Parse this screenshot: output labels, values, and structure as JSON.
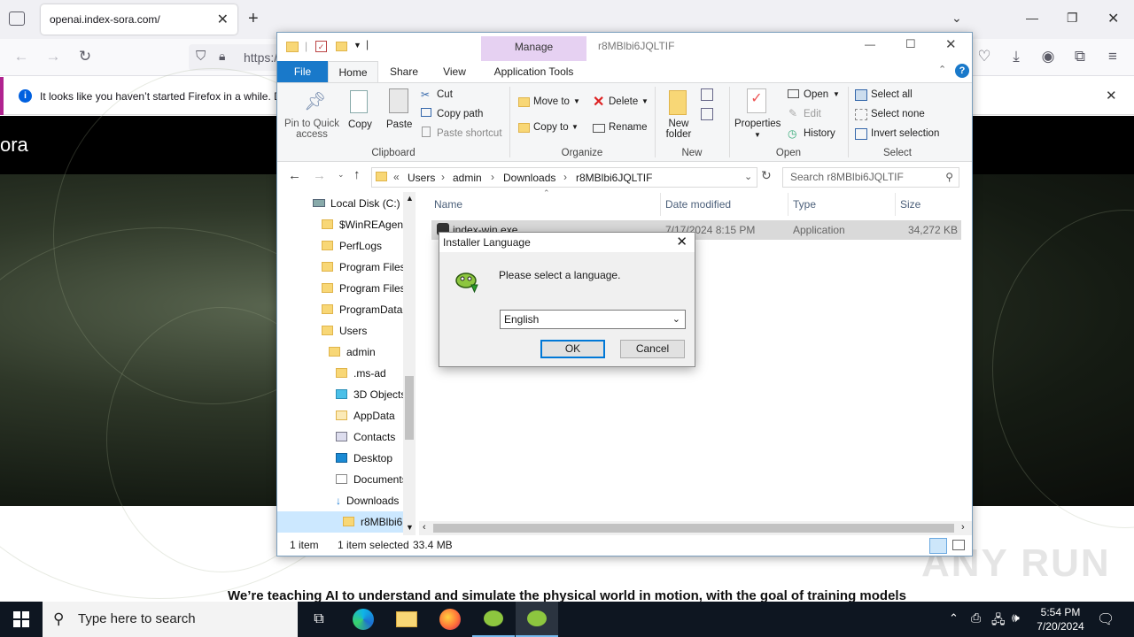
{
  "browser": {
    "tab_title": "openai.index-sora.com/",
    "url_partial": "https:/",
    "notification": "It looks like you haven’t started Firefox in a while. D",
    "new_tab_symbol": "+"
  },
  "page": {
    "brand": "ora",
    "tagline": "We’re teaching AI to understand and simulate the physical world in motion, with the goal of training models",
    "watermark": "ANY RUN"
  },
  "explorer": {
    "window_title": "r8MBlbi6JQLTIF",
    "context_tab": "Manage",
    "tabs": [
      "File",
      "Home",
      "Share",
      "View",
      "Application Tools"
    ],
    "ribbon": {
      "pin": "Pin to Quick access",
      "copy": "Copy",
      "paste": "Paste",
      "cut": "Cut",
      "copy_path": "Copy path",
      "paste_shortcut": "Paste shortcut",
      "move_to": "Move to",
      "copy_to": "Copy to",
      "delete": "Delete",
      "rename": "Rename",
      "new_folder": "New folder",
      "properties": "Properties",
      "open": "Open",
      "edit": "Edit",
      "history": "History",
      "select_all": "Select all",
      "select_none": "Select none",
      "invert_selection": "Invert selection",
      "groups": [
        "Clipboard",
        "Organize",
        "New",
        "Open",
        "Select"
      ]
    },
    "breadcrumb": [
      "Users",
      "admin",
      "Downloads",
      "r8MBlbi6JQLTIF"
    ],
    "search_placeholder": "Search r8MBlbi6JQLTIF",
    "nav_items": [
      "Local Disk (C:)",
      "$WinREAgent",
      "PerfLogs",
      "Program Files",
      "Program Files",
      "ProgramData",
      "Users",
      "admin",
      ".ms-ad",
      "3D Objects",
      "AppData",
      "Contacts",
      "Desktop",
      "Documents",
      "Downloads",
      "r8MBlbi6"
    ],
    "columns": [
      "Name",
      "Date modified",
      "Type",
      "Size"
    ],
    "files": [
      {
        "name": "index-win.exe",
        "date": "7/17/2024 8:15 PM",
        "type": "Application",
        "size": "34,272 KB"
      }
    ],
    "status": {
      "count": "1 item",
      "selected": "1 item selected",
      "size": "33.4 MB"
    }
  },
  "dialog": {
    "title": "Installer Language",
    "message": "Please select a language.",
    "selected_language": "English",
    "ok": "OK",
    "cancel": "Cancel"
  },
  "taskbar": {
    "search_placeholder": "Type here to search",
    "time": "5:54 PM",
    "date": "7/20/2024"
  }
}
